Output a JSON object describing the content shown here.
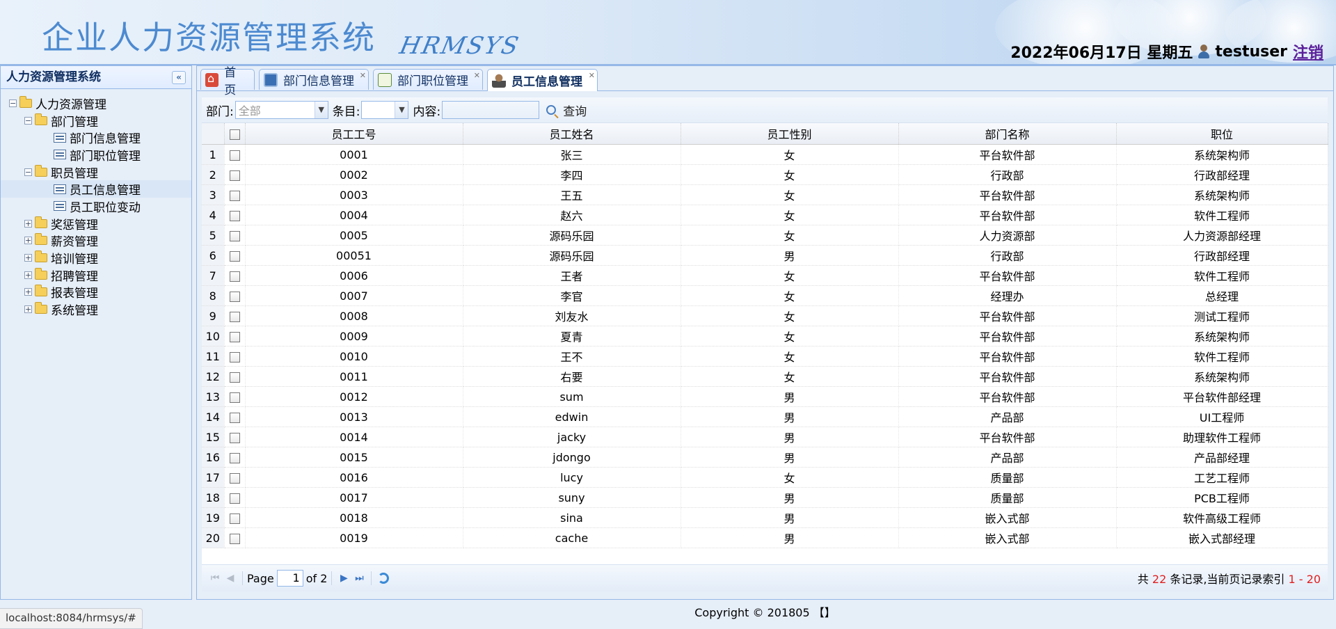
{
  "header": {
    "title_cn": "企业人力资源管理系统",
    "title_en": "HRMSYS",
    "date": "2022年06月17日 星期五",
    "username": "testuser",
    "logout": "注销"
  },
  "sidebar": {
    "title": "人力资源管理系统",
    "root": "人力资源管理",
    "groups": [
      {
        "label": "部门管理",
        "expanded": true,
        "children": [
          "部门信息管理",
          "部门职位管理"
        ]
      },
      {
        "label": "职员管理",
        "expanded": true,
        "children": [
          "员工信息管理",
          "员工职位变动"
        ]
      },
      {
        "label": "奖惩管理",
        "expanded": false
      },
      {
        "label": "薪资管理",
        "expanded": false
      },
      {
        "label": "培训管理",
        "expanded": false
      },
      {
        "label": "招聘管理",
        "expanded": false
      },
      {
        "label": "报表管理",
        "expanded": false
      },
      {
        "label": "系统管理",
        "expanded": false
      }
    ]
  },
  "tabs": [
    {
      "label": "首页",
      "icon": "home-icon",
      "closable": false,
      "active": false
    },
    {
      "label": "部门信息管理",
      "icon": "monitor-icon",
      "closable": true,
      "active": false
    },
    {
      "label": "部门职位管理",
      "icon": "grid-icon",
      "closable": true,
      "active": false
    },
    {
      "label": "员工信息管理",
      "icon": "person-icon",
      "closable": true,
      "active": true
    }
  ],
  "filters": {
    "dept_label": "部门:",
    "dept_value": "全部",
    "item_label": "条目:",
    "item_value": "",
    "content_label": "内容:",
    "content_value": "",
    "search_label": "查询"
  },
  "table": {
    "columns": [
      "员工工号",
      "员工姓名",
      "员工性别",
      "部门名称",
      "职位"
    ],
    "rows": [
      [
        "0001",
        "张三",
        "女",
        "平台软件部",
        "系统架构师"
      ],
      [
        "0002",
        "李四",
        "女",
        "行政部",
        "行政部经理"
      ],
      [
        "0003",
        "王五",
        "女",
        "平台软件部",
        "系统架构师"
      ],
      [
        "0004",
        "赵六",
        "女",
        "平台软件部",
        "软件工程师"
      ],
      [
        "0005",
        "源码乐园",
        "女",
        "人力资源部",
        "人力资源部经理"
      ],
      [
        "00051",
        "源码乐园",
        "男",
        "行政部",
        "行政部经理"
      ],
      [
        "0006",
        "王者",
        "女",
        "平台软件部",
        "软件工程师"
      ],
      [
        "0007",
        "李官",
        "女",
        "经理办",
        "总经理"
      ],
      [
        "0008",
        "刘友水",
        "女",
        "平台软件部",
        "测试工程师"
      ],
      [
        "0009",
        "夏青",
        "女",
        "平台软件部",
        "系统架构师"
      ],
      [
        "0010",
        "王不",
        "女",
        "平台软件部",
        "软件工程师"
      ],
      [
        "0011",
        "右要",
        "女",
        "平台软件部",
        "系统架构师"
      ],
      [
        "0012",
        "sum",
        "男",
        "平台软件部",
        "平台软件部经理"
      ],
      [
        "0013",
        "edwin",
        "男",
        "产品部",
        "UI工程师"
      ],
      [
        "0014",
        "jacky",
        "男",
        "平台软件部",
        "助理软件工程师"
      ],
      [
        "0015",
        "jdongo",
        "男",
        "产品部",
        "产品部经理"
      ],
      [
        "0016",
        "lucy",
        "女",
        "质量部",
        "工艺工程师"
      ],
      [
        "0017",
        "suny",
        "男",
        "质量部",
        "PCB工程师"
      ],
      [
        "0018",
        "sina",
        "男",
        "嵌入式部",
        "软件高级工程师"
      ],
      [
        "0019",
        "cache",
        "男",
        "嵌入式部",
        "嵌入式部经理"
      ]
    ]
  },
  "pager": {
    "page_label": "Page",
    "page_value": "1",
    "of_label": "of 2",
    "info_prefix": "共 ",
    "total": "22",
    "info_middle": " 条记录,当前页记录索引 ",
    "range": "1 - 20"
  },
  "footer": "Copyright © 201805 【】",
  "statusbar": "localhost:8084/hrmsys/#"
}
